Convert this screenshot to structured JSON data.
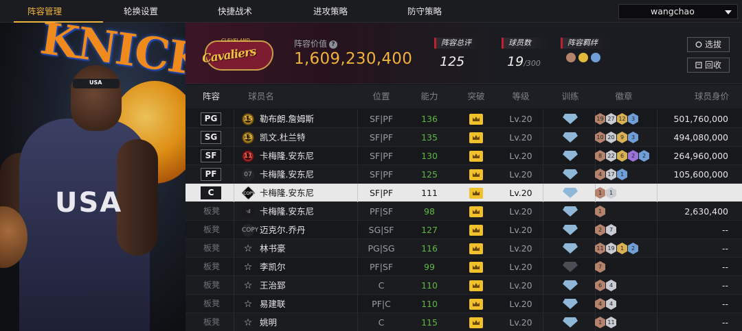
{
  "nav": {
    "tabs": [
      "阵容管理",
      "轮换设置",
      "快捷战术",
      "进攻策略",
      "防守策略"
    ],
    "user": "wangchao"
  },
  "art": {
    "headband": "USA",
    "jersey": "USA"
  },
  "summary": {
    "value_label": "阵容价值",
    "value": "1,609,230,400",
    "stats": {
      "rating_label": "阵容总评",
      "rating": "125",
      "players_label": "球员数",
      "players": "19",
      "players_max": "/300",
      "bond_label": "阵容羁绊"
    },
    "buttons": {
      "pick": "选拔",
      "recycle": "回收"
    }
  },
  "table": {
    "headers": [
      "阵容",
      "球员名",
      "位置",
      "能力",
      "突破",
      "等级",
      "训练",
      "徽章",
      "球员身价"
    ],
    "rows": [
      {
        "slot": "PG",
        "rank": "15",
        "rank_style": "gold",
        "name": "勒布朗.詹姆斯",
        "pos": "SF|PF",
        "ability": "136",
        "level": "Lv.20",
        "train": "on",
        "badges": [
          [
            "19",
            "bronze"
          ],
          [
            "27",
            "silver"
          ],
          [
            "12",
            "gold"
          ],
          [
            "3",
            "blue"
          ]
        ],
        "price": "501,760,000"
      },
      {
        "slot": "SG",
        "rank": "13",
        "rank_style": "gold",
        "name": "凯文.杜兰特",
        "pos": "SF|PF",
        "ability": "135",
        "level": "Lv.20",
        "train": "on",
        "badges": [
          [
            "10",
            "bronze"
          ],
          [
            "20",
            "silver"
          ],
          [
            "9",
            "gold"
          ],
          [
            "3",
            "blue"
          ]
        ],
        "price": "494,080,000"
      },
      {
        "slot": "SF",
        "rank": "11",
        "rank_style": "red",
        "name": "卡梅隆.安东尼",
        "pos": "SF|PF",
        "ability": "130",
        "level": "Lv.20",
        "train": "on",
        "badges": [
          [
            "8",
            "bronze"
          ],
          [
            "22",
            "silver"
          ],
          [
            "6",
            "gold"
          ],
          [
            "2",
            "purple"
          ],
          [
            "2",
            "blue"
          ]
        ],
        "price": "264,960,000"
      },
      {
        "slot": "PF",
        "rank": "07",
        "rank_style": "plain",
        "name": "卡梅隆.安东尼",
        "pos": "SF|PF",
        "ability": "125",
        "level": "Lv.20",
        "train": "on",
        "badges": [
          [
            "4",
            "bronze"
          ],
          [
            "17",
            "silver"
          ],
          [
            "1",
            "blue"
          ]
        ],
        "price": "105,600,000"
      },
      {
        "slot": "C",
        "rank": "COPY",
        "rank_style": "copy",
        "name": "卡梅隆.安东尼",
        "pos": "SF|PF",
        "ability": "111",
        "level": "Lv.20",
        "train": "on",
        "badges": [
          [
            "1",
            "bronze"
          ],
          [
            "1",
            "silver"
          ]
        ],
        "price": "--"
      },
      {
        "slot": "板凳",
        "rank": "·ıl",
        "rank_style": "bar",
        "name": "卡梅隆.安东尼",
        "pos": "PF|SF",
        "ability": "98",
        "level": "Lv.20",
        "train": "on",
        "badges": [
          [
            "1",
            "bronze"
          ]
        ],
        "price": "2,630,400"
      },
      {
        "slot": "板凳",
        "rank": "COPY",
        "rank_style": "plain",
        "name": "迈克尔.乔丹",
        "pos": "SG|SF",
        "ability": "127",
        "level": "Lv.20",
        "train": "on",
        "badges": [
          [
            "2",
            "bronze"
          ],
          [
            "7",
            "silver"
          ]
        ],
        "price": "--"
      },
      {
        "slot": "板凳",
        "rank": "☆",
        "rank_style": "star",
        "name": "林书豪",
        "pos": "PG|SG",
        "ability": "116",
        "level": "Lv.20",
        "train": "on",
        "badges": [
          [
            "11",
            "bronze"
          ],
          [
            "19",
            "silver"
          ],
          [
            "1",
            "gold"
          ],
          [
            "2",
            "blue"
          ]
        ],
        "price": "--"
      },
      {
        "slot": "板凳",
        "rank": "☆",
        "rank_style": "star",
        "name": "李凯尔",
        "pos": "PF|SF",
        "ability": "99",
        "level": "Lv.20",
        "train": "off",
        "badges": [
          [
            "7",
            "bronze"
          ]
        ],
        "price": "--"
      },
      {
        "slot": "板凳",
        "rank": "☆",
        "rank_style": "star",
        "name": "王治郅",
        "pos": "C",
        "ability": "110",
        "level": "Lv.20",
        "train": "on",
        "badges": [
          [
            "6",
            "bronze"
          ],
          [
            "4",
            "silver"
          ]
        ],
        "price": "--"
      },
      {
        "slot": "板凳",
        "rank": "☆",
        "rank_style": "star",
        "name": "易建联",
        "pos": "PF|C",
        "ability": "110",
        "level": "Lv.20",
        "train": "on",
        "badges": [
          [
            "4",
            "bronze"
          ],
          [
            "4",
            "silver"
          ]
        ],
        "price": "--"
      },
      {
        "slot": "板凳",
        "rank": "☆",
        "rank_style": "star",
        "name": "姚明",
        "pos": "C",
        "ability": "115",
        "level": "Lv.20",
        "train": "on",
        "badges": [
          [
            "1",
            "bronze"
          ],
          [
            "11",
            "silver"
          ]
        ],
        "price": "--"
      }
    ],
    "selected_index": 4
  },
  "colors": {
    "accent": "#f2b53b",
    "value": "#f0b23a",
    "ability": "#5fb944",
    "stat_marker": "#c4202f"
  }
}
